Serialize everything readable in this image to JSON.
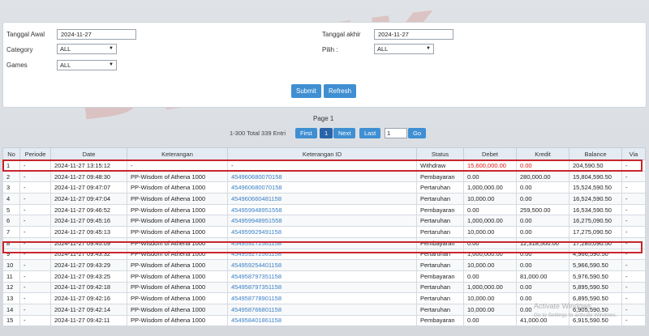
{
  "filter": {
    "tanggal_awal_label": "Tanggal Awal",
    "tanggal_awal_value": "2024-11-27",
    "category_label": "Category",
    "category_value": "ALL",
    "games_label": "Games",
    "games_value": "ALL",
    "tanggal_akhir_label": "Tanggal akhir",
    "tanggal_akhir_value": "2024-11-27",
    "pilih_label": "Pilih :",
    "pilih_value": "ALL",
    "submit_label": "Submit",
    "refresh_label": "Refresh"
  },
  "pager": {
    "title": "Page 1",
    "info": "1-300 Total 339 Entri",
    "first": "First",
    "current": "1",
    "next": "Next",
    "last": "Last",
    "page_input": "1",
    "go": "Go"
  },
  "table": {
    "headers": [
      "No",
      "Periode",
      "Date",
      "Keterangan",
      "Keterangan ID",
      "Status",
      "Debet",
      "Kredit",
      "Balance",
      "Via"
    ],
    "rows": [
      {
        "no": "1",
        "periode": "-",
        "date": "2024-11-27 13:15:12",
        "ket": "-",
        "ket_id": "-",
        "status": "Withdraw",
        "debet": "15,600,000.00",
        "kredit": "0.00",
        "balance": "204,590.50",
        "via": "-"
      },
      {
        "no": "2",
        "periode": "-",
        "date": "2024-11-27 09:48:30",
        "ket": "PP-Wisdom of Athena 1000",
        "ket_id": "454960680070158",
        "status": "Pembayaran",
        "debet": "0.00",
        "kredit": "280,000.00",
        "balance": "15,804,590.50",
        "via": "-"
      },
      {
        "no": "3",
        "periode": "-",
        "date": "2024-11-27 09:47:07",
        "ket": "PP-Wisdom of Athena 1000",
        "ket_id": "454960680070158",
        "status": "Pertaruhan",
        "debet": "1,000,000.00",
        "kredit": "0.00",
        "balance": "15,524,590.50",
        "via": "-"
      },
      {
        "no": "4",
        "periode": "-",
        "date": "2024-11-27 09:47:04",
        "ket": "PP-Wisdom of Athena 1000",
        "ket_id": "454960660481158",
        "status": "Pertaruhan",
        "debet": "10,000.00",
        "kredit": "0.00",
        "balance": "16,524,590.50",
        "via": "-"
      },
      {
        "no": "5",
        "periode": "-",
        "date": "2024-11-27 09:46:52",
        "ket": "PP-Wisdom of Athena 1000",
        "ket_id": "454959948951558",
        "status": "Pembayaran",
        "debet": "0.00",
        "kredit": "259,500.00",
        "balance": "16,534,590.50",
        "via": "-"
      },
      {
        "no": "6",
        "periode": "-",
        "date": "2024-11-27 09:45:16",
        "ket": "PP-Wisdom of Athena 1000",
        "ket_id": "454959948951558",
        "status": "Pertaruhan",
        "debet": "1,000,000.00",
        "kredit": "0.00",
        "balance": "16,275,090.50",
        "via": "-"
      },
      {
        "no": "7",
        "periode": "-",
        "date": "2024-11-27 09:45:13",
        "ket": "PP-Wisdom of Athena 1000",
        "ket_id": "454959929491158",
        "status": "Pertaruhan",
        "debet": "10,000.00",
        "kredit": "0.00",
        "balance": "17,275,090.50",
        "via": "-"
      },
      {
        "no": "8",
        "periode": "-",
        "date": "2024-11-27 09:45:09",
        "ket": "PP-Wisdom of Athena 1000",
        "ket_id": "454959272561158",
        "status": "Pembayaran",
        "debet": "0.00",
        "kredit": "12,318,500.00",
        "balance": "17,285,090.50",
        "via": "-"
      },
      {
        "no": "9",
        "periode": "-",
        "date": "2024-11-27 09:43:32",
        "ket": "PP-Wisdom of Athena 1000",
        "ket_id": "454959272561158",
        "status": "Pertaruhan",
        "debet": "1,000,000.00",
        "kredit": "0.00",
        "balance": "4,966,590.50",
        "via": "-"
      },
      {
        "no": "10",
        "periode": "-",
        "date": "2024-11-27 09:43:29",
        "ket": "PP-Wisdom of Athena 1000",
        "ket_id": "454959254401158",
        "status": "Pertaruhan",
        "debet": "10,000.00",
        "kredit": "0.00",
        "balance": "5,966,590.50",
        "via": "-"
      },
      {
        "no": "11",
        "periode": "-",
        "date": "2024-11-27 09:43:25",
        "ket": "PP-Wisdom of Athena 1000",
        "ket_id": "454958797351158",
        "status": "Pembayaran",
        "debet": "0.00",
        "kredit": "81,000.00",
        "balance": "5,976,590.50",
        "via": "-"
      },
      {
        "no": "12",
        "periode": "-",
        "date": "2024-11-27 09:42:18",
        "ket": "PP-Wisdom of Athena 1000",
        "ket_id": "454958797351158",
        "status": "Pertaruhan",
        "debet": "1,000,000.00",
        "kredit": "0.00",
        "balance": "5,895,590.50",
        "via": "-"
      },
      {
        "no": "13",
        "periode": "-",
        "date": "2024-11-27 09:42:16",
        "ket": "PP-Wisdom of Athena 1000",
        "ket_id": "454958778901158",
        "status": "Pertaruhan",
        "debet": "10,000.00",
        "kredit": "0.00",
        "balance": "6,895,590.50",
        "via": "-"
      },
      {
        "no": "14",
        "periode": "-",
        "date": "2024-11-27 09:42:14",
        "ket": "PP-Wisdom of Athena 1000",
        "ket_id": "454958766801158",
        "status": "Pertaruhan",
        "debet": "10,000.00",
        "kredit": "0.00",
        "balance": "6,905,590.50",
        "via": "-"
      },
      {
        "no": "15",
        "periode": "-",
        "date": "2024-11-27 09:42:11",
        "ket": "PP-Wisdom of Athena 1000",
        "ket_id": "454958401861158",
        "status": "Pembayaran",
        "debet": "0.00",
        "kredit": "41,000.00",
        "balance": "6,915,590.50",
        "via": "-"
      }
    ]
  },
  "watermark": "DIVLIK",
  "windows_notice": {
    "title": "Activate Windows",
    "subtitle": "Go to Settings to activate Windows."
  },
  "colors": {
    "accent": "#3f8fd2",
    "highlight_border": "#c8252c",
    "link": "#3a7fc4",
    "debit_red": "#dd1111"
  }
}
